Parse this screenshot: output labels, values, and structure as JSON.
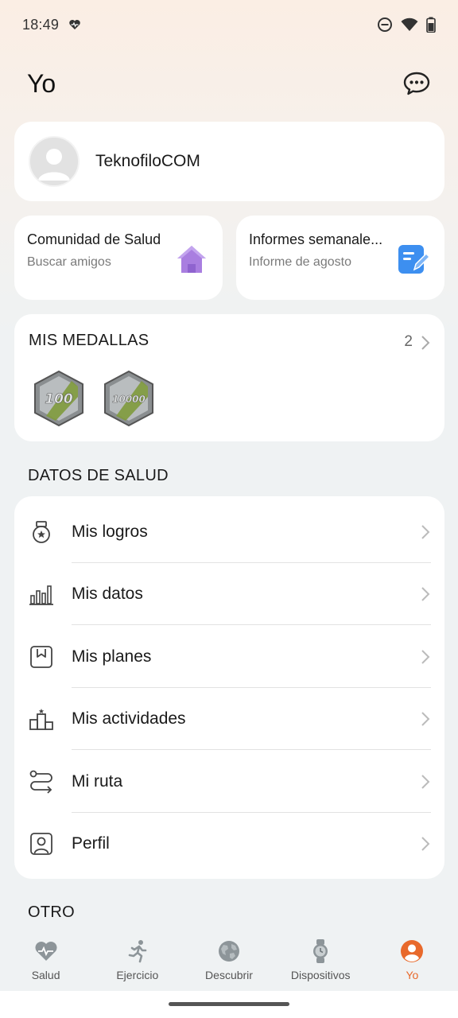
{
  "status_bar": {
    "time": "18:49",
    "icons": [
      "heart-rate-icon",
      "do-not-disturb-icon",
      "wifi-icon",
      "battery-icon"
    ]
  },
  "header": {
    "title": "Yo",
    "chat_icon": "chat-bubble-icon"
  },
  "profile": {
    "username": "TeknofiloCOM"
  },
  "quick_cards": [
    {
      "title": "Comunidad de Salud",
      "subtitle": "Buscar amigos",
      "icon": "house-icon"
    },
    {
      "title": "Informes semanale...",
      "subtitle": "Informe de agosto",
      "icon": "report-pencil-icon"
    }
  ],
  "medals": {
    "title": "MIS MEDALLAS",
    "count": "2",
    "items": [
      {
        "label": "100"
      },
      {
        "label": "10000"
      }
    ]
  },
  "health_section": {
    "title": "DATOS DE SALUD",
    "rows": [
      {
        "label": "Mis logros",
        "icon": "medal-icon"
      },
      {
        "label": "Mis datos",
        "icon": "bar-chart-icon"
      },
      {
        "label": "Mis planes",
        "icon": "bookmark-plan-icon"
      },
      {
        "label": "Mis actividades",
        "icon": "podium-icon"
      },
      {
        "label": "Mi ruta",
        "icon": "route-icon"
      },
      {
        "label": "Perfil",
        "icon": "profile-card-icon"
      }
    ]
  },
  "other_section": {
    "title": "OTRO"
  },
  "bottom_nav": {
    "items": [
      {
        "label": "Salud",
        "icon": "heart-icon",
        "active": false
      },
      {
        "label": "Ejercicio",
        "icon": "runner-icon",
        "active": false
      },
      {
        "label": "Descubrir",
        "icon": "globe-icon",
        "active": false
      },
      {
        "label": "Dispositivos",
        "icon": "watch-icon",
        "active": false
      },
      {
        "label": "Yo",
        "icon": "person-icon",
        "active": true
      }
    ]
  },
  "colors": {
    "accent": "#e8692b",
    "card": "#ffffff",
    "background": "#eff2f3",
    "house_icon": "#a97ee0",
    "report_icon": "#3d8ff0"
  }
}
